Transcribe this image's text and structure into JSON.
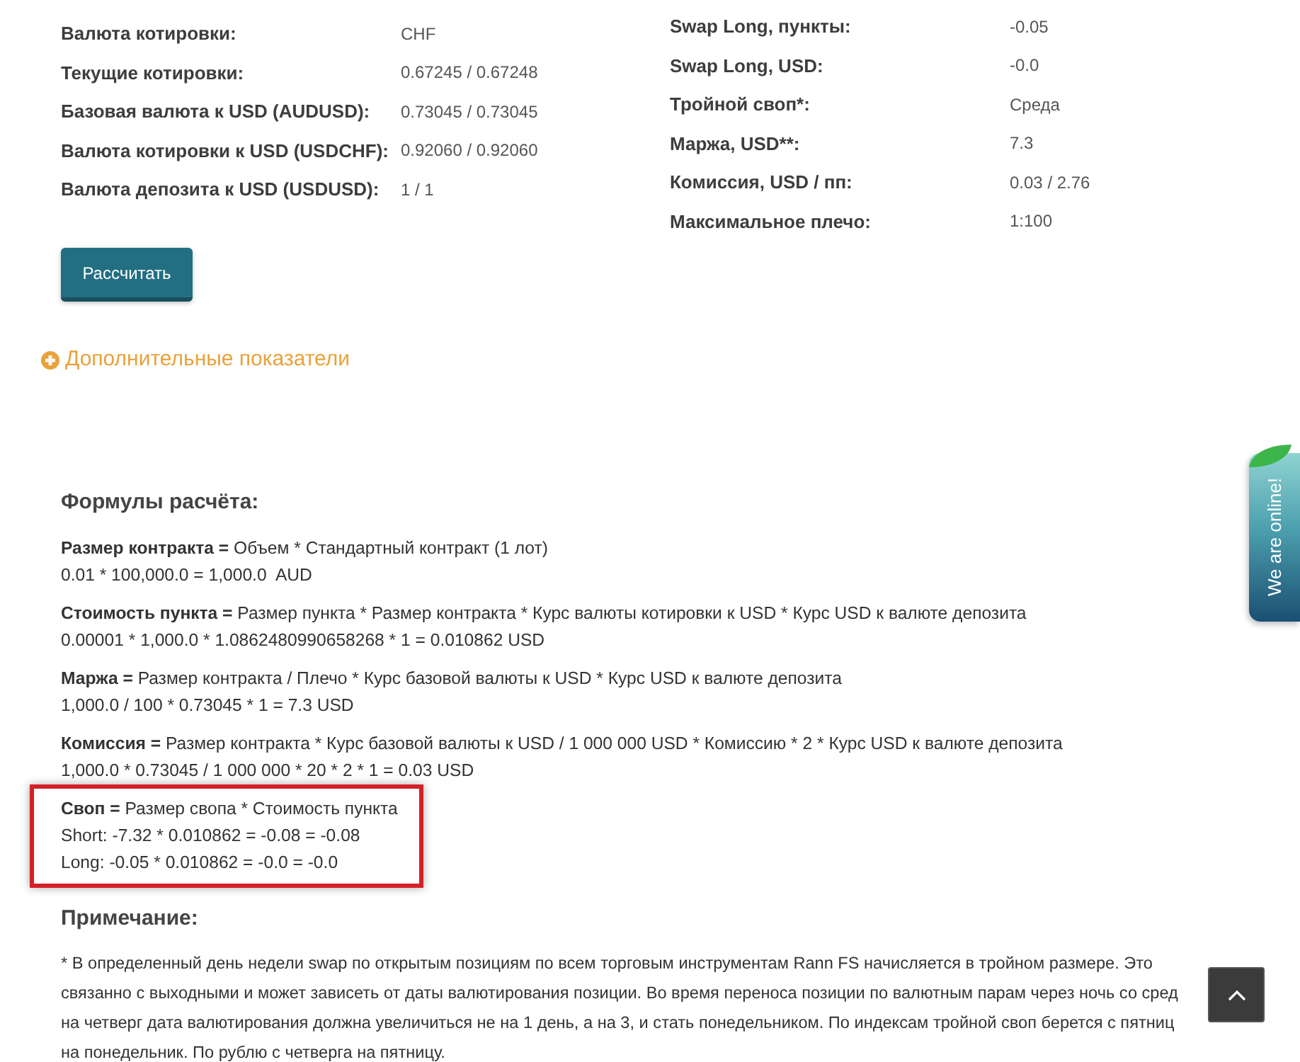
{
  "left_fields": [
    {
      "label": "Валюта котировки:",
      "value": "CHF"
    },
    {
      "label": "Текущие котировки:",
      "value": "0.67245 / 0.67248"
    },
    {
      "label": "Базовая валюта к USD (AUDUSD):",
      "value": "0.73045 / 0.73045"
    },
    {
      "label": "Валюта котировки к USD (USDCHF):",
      "value": "0.92060 / 0.92060"
    },
    {
      "label": "Валюта депозита к USD (USDUSD):",
      "value": "1 / 1"
    }
  ],
  "right_fields": [
    {
      "label": "Swap Long, пункты:",
      "value": "-0.05"
    },
    {
      "label": "Swap Long, USD:",
      "value": "-0.0"
    },
    {
      "label": "Тройной своп*:",
      "value": "Среда"
    },
    {
      "label": "Маржа, USD**:",
      "value": "7.3"
    },
    {
      "label": "Комиссия, USD / пп:",
      "value": "0.03 / 2.76"
    },
    {
      "label": "Максимальное плечо:",
      "value": "1:100"
    }
  ],
  "calculate_button": {
    "label": "Рассчитать"
  },
  "more_indicators": {
    "label": "Дополнительные показатели",
    "expanded": false
  },
  "formulas": {
    "title": "Формулы расчёта:",
    "items": [
      {
        "term": "Размер контракта =",
        "definition": "Объем * Стандартный контракт (1 лот)",
        "lines": [
          "0.01 * 100,000.0 = 1,000.0  AUD"
        ],
        "highlighted": false
      },
      {
        "term": "Стоимость пункта =",
        "definition": "Размер пункта * Размер контракта * Курс валюты котировки к USD * Курс USD к валюте депозита",
        "lines": [
          "0.00001 * 1,000.0 * 1.0862480990658268 * 1 = 0.010862 USD"
        ],
        "highlighted": false
      },
      {
        "term": "Маржа =",
        "definition": "Размер контракта / Плечо * Курс базовой валюты к USD * Курс USD к валюте депозита",
        "lines": [
          "1,000.0 / 100 * 0.73045 * 1 = 7.3 USD"
        ],
        "highlighted": false
      },
      {
        "term": "Комиссия =",
        "definition": "Размер контракта * Курс базовой валюты к USD / 1 000 000 USD * Комиссию * 2 * Курс USD к валюте депозита",
        "lines": [
          "1,000.0 * 0.73045 / 1 000 000 * 20 * 2 * 1 = 0.03 USD"
        ],
        "highlighted": false
      },
      {
        "term": "Своп =",
        "definition": "Размер свопа * Стоимость пункта",
        "lines": [
          "Short: -7.32 * 0.010862 = -0.08 = -0.08",
          "Long: -0.05 * 0.010862 = -0.0 = -0.0"
        ],
        "highlighted": true
      }
    ]
  },
  "note": {
    "title": "Примечание:",
    "text": "* В определенный день недели swap по открытым позициям по всем торговым инструментам Rann FS начисляется в тройном размере. Это\nсвязанно с выходными и может зависеть от даты валютирования позиции. Во время переноса позиции по валютным парам через ночь со сред\nна четверг дата валютирования должна увеличиться не на 1 день, а на 3, и стать понедельником. По индексам тройной своп берется с пятниц\nна понедельник. По рублю с четверга на пятницу."
  },
  "chat_tab": {
    "label": "We are online!"
  }
}
